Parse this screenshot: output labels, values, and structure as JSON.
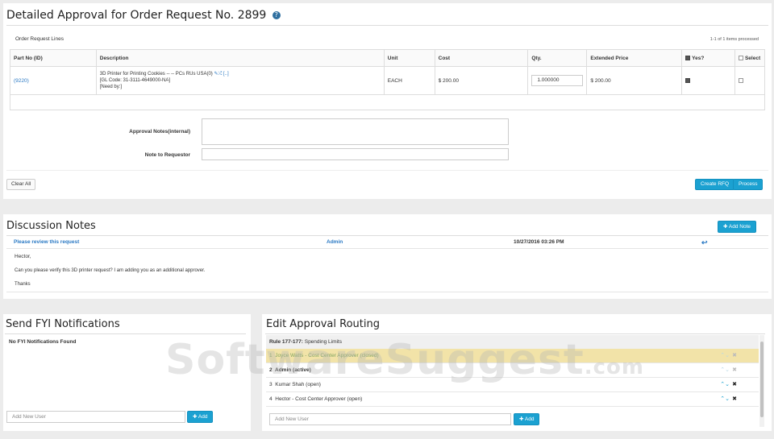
{
  "order": {
    "title": "Detailed Approval for Order Request No. 2899",
    "lines_label": "Order Request Lines",
    "items_processed": "1-1 of 1 items processed",
    "columns": [
      "Part No (ID)",
      "Description",
      "Unit",
      "Cost",
      "Qty.",
      "Extended Price",
      "Yes?",
      "Select"
    ],
    "row": {
      "part_no": "(9220)",
      "desc_line1": "3D Printer for Printing Cookies -- -- PCs RUs USA(0)",
      "desc_edit": "✎",
      "desc_shuffle": "⤮",
      "desc_bracket": "[..]",
      "desc_line2": "[GL Code: 31-3111-4649000-NA]",
      "desc_line3": "[Need by:]",
      "unit": "EACH",
      "cost": "$ 200.00",
      "qty": "1.000000",
      "extended": "$ 200.00"
    },
    "approval_notes_label": "Approval Notes(internal)",
    "note_requestor_label": "Note to Requestor",
    "clear_all": "Clear All",
    "create_rfq": "Create RFQ",
    "process": "Process"
  },
  "discussion": {
    "title": "Discussion Notes",
    "add_note": "Add Note",
    "subject": "Please review this request",
    "author": "Admin",
    "date": "10/27/2016 03:26 PM",
    "body1": "Hector,",
    "body2": "Can you please verify this 3D printer request? I am adding you as an additional approver.",
    "body3": "Thanks"
  },
  "fyi": {
    "title": "Send FYI Notifications",
    "empty": "No FYI Notifications Found",
    "placeholder": "Add New User",
    "add": "Add"
  },
  "routing": {
    "title": "Edit Approval Routing",
    "rule_bold": "Rule 177-177:",
    "rule_text": "Spending Limits",
    "rows": [
      {
        "num": "1",
        "text": "Joyce Watts - Cost Center Approver (closed)"
      },
      {
        "num": "2",
        "text": "Admin (active)"
      },
      {
        "num": "3",
        "text": "Kumar Shah (open)"
      },
      {
        "num": "4",
        "text": "Hector - Cost Center Approver (open)"
      }
    ],
    "placeholder": "Add New User",
    "add": "Add"
  },
  "watermark": {
    "main": "SoftwareSuggest",
    "suffix": ".com"
  },
  "icons": {
    "help": "help-circle-icon",
    "plus": "plus-icon",
    "reply": "reply-icon",
    "up": "chevron-up-icon",
    "down": "chevron-down-icon",
    "remove": "close-icon"
  },
  "colors": {
    "accent": "#1ba1d1",
    "link": "#2a79c4",
    "highlight_row": "#f2e3a8"
  }
}
